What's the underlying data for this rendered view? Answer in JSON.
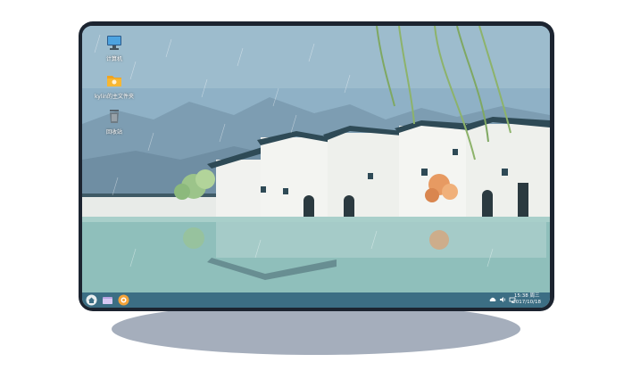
{
  "desktop": {
    "icons": [
      {
        "label": "计算机",
        "icon": "computer-icon"
      },
      {
        "label": "kylin的主文件夹",
        "icon": "folder-icon"
      },
      {
        "label": "回收站",
        "icon": "trash-icon"
      }
    ]
  },
  "taskbar": {
    "launchers": [
      "start-menu-icon",
      "file-manager-icon",
      "browser-icon"
    ],
    "tray": [
      "cloud-icon",
      "volume-icon",
      "network-icon"
    ],
    "time": "15:38 周三",
    "date": "2017/10/18"
  },
  "colors": {
    "sky": "#8fb1c6",
    "water": "#8fbfbb",
    "taskbar": "#3c6e84",
    "frame": "#1c2430",
    "shadow": "#a5aebc"
  }
}
